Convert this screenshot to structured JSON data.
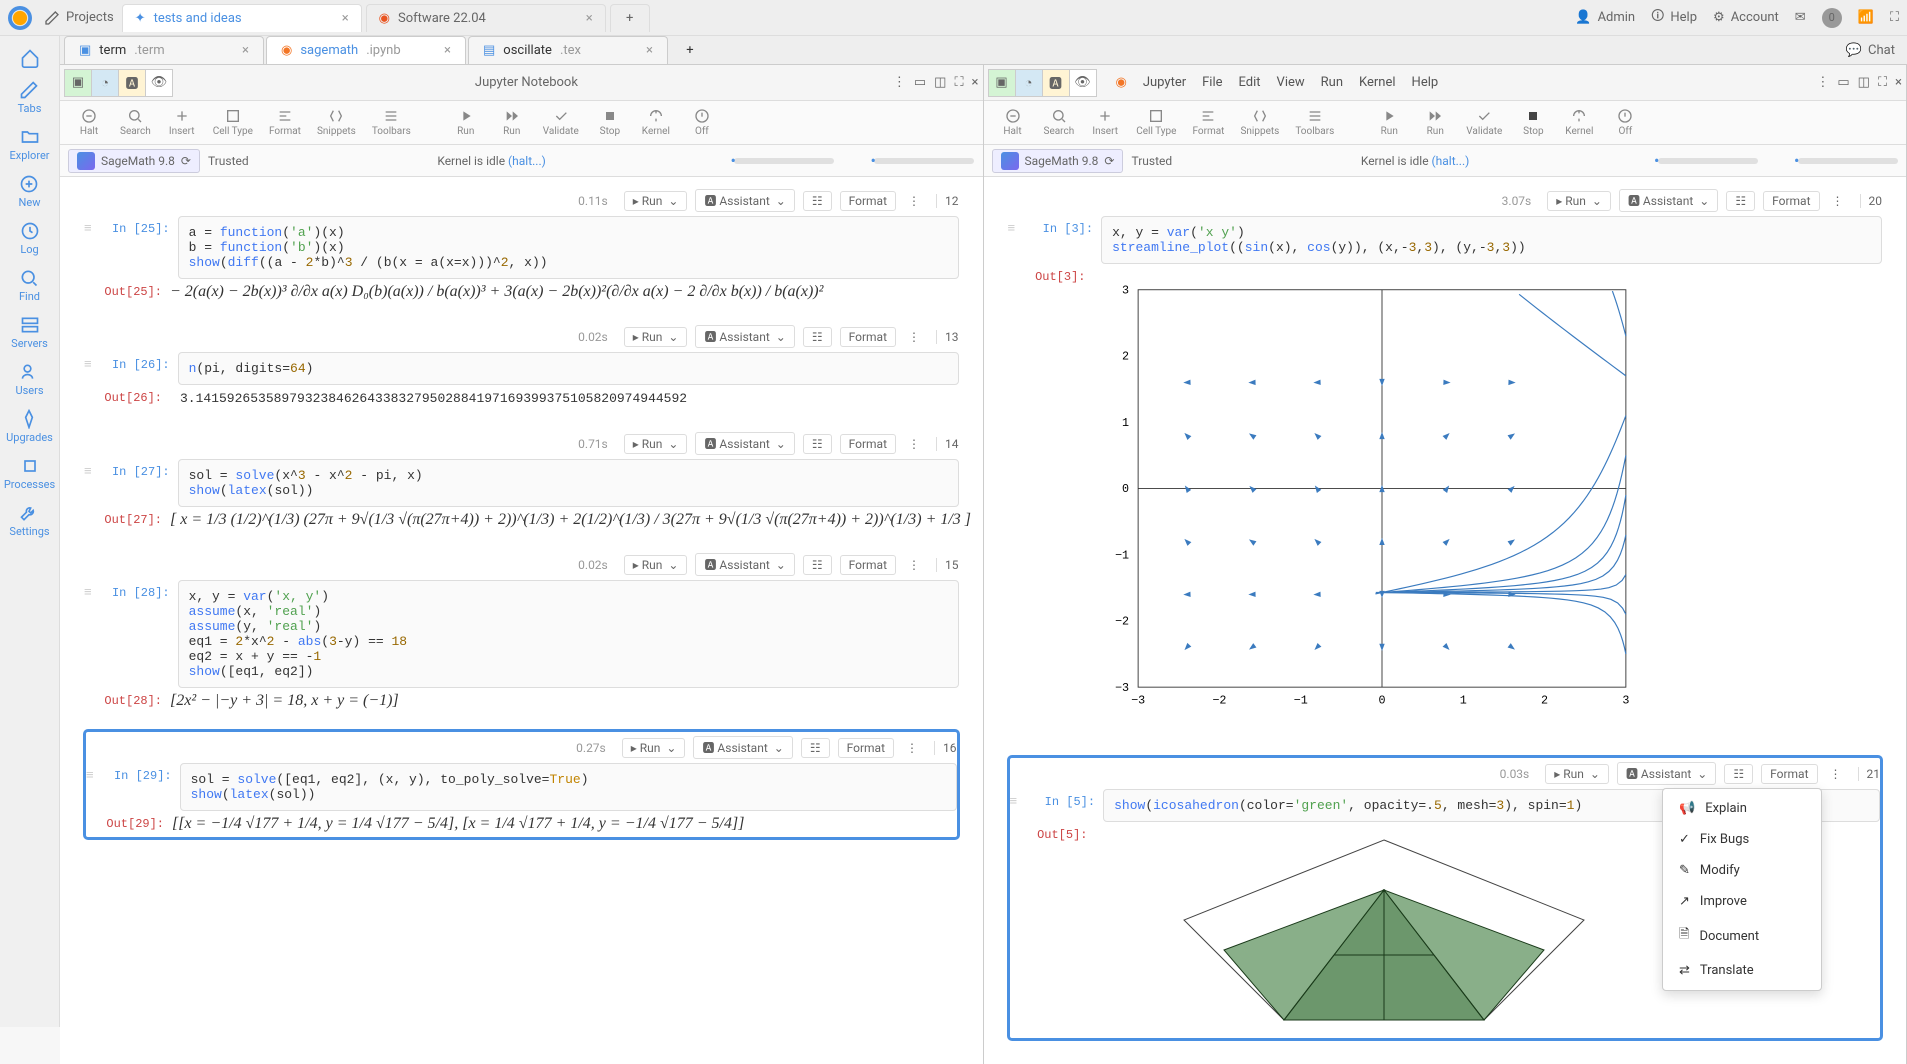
{
  "topbar": {
    "projects_label": "Projects",
    "tabs": [
      {
        "label": "tests and ideas",
        "active": true
      },
      {
        "label": "Software 22.04",
        "active": false
      }
    ],
    "admin": "Admin",
    "help": "Help",
    "account": "Account",
    "notif_count": "0"
  },
  "rail": {
    "tabs": "Tabs",
    "explorer": "Explorer",
    "new": "New",
    "log": "Log",
    "find": "Find",
    "servers": "Servers",
    "users": "Users",
    "upgrades": "Upgrades",
    "processes": "Processes",
    "settings": "Settings"
  },
  "file_tabs": [
    {
      "name": "term",
      "ext": ".term",
      "active": false
    },
    {
      "name": "sagemath",
      "ext": ".ipynb",
      "active": true
    },
    {
      "name": "oscillate",
      "ext": ".tex",
      "active": false
    }
  ],
  "chat_label": "Chat",
  "left_pane": {
    "header_title": "Jupyter Notebook",
    "kernel_name": "SageMath 9.8",
    "trusted": "Trusted",
    "kernel_status": "Kernel is idle",
    "halt": "(halt...)",
    "cells": [
      {
        "n": "12",
        "timing": "0.11s",
        "in_label": "In [25]:",
        "out_label": "Out[25]:",
        "code": "a = function('a')(x)\nb = function('b')(x)\nshow(diff((a - 2*b)^3 / (b(x = a(x=x)))^2, x))",
        "output_math": "− 2(a(x) − 2b(x))³ ∂/∂x a(x) D₀(b)(a(x)) / b(a(x))³  +  3(a(x) − 2b(x))²(∂/∂x a(x) − 2 ∂/∂x b(x)) / b(a(x))²"
      },
      {
        "n": "13",
        "timing": "0.02s",
        "in_label": "In [26]:",
        "out_label": "Out[26]:",
        "code": "n(pi, digits=64)",
        "output_text": "3.141592653589793238462643383279502884197169399375105820974944592"
      },
      {
        "n": "14",
        "timing": "0.71s",
        "in_label": "In [27]:",
        "out_label": "Out[27]:",
        "code": "sol = solve(x^3 - x^2 - pi, x)\nshow(latex(sol))",
        "output_math": "[ x = 1/3 (1/2)^(1/3) (27π + 9√(1/3 √(π(27π+4)) + 2))^(1/3)  +  2(1/2)^(1/3) / 3(27π + 9√(1/3 √(π(27π+4)) + 2))^(1/3)  +  1/3 ]"
      },
      {
        "n": "15",
        "timing": "0.02s",
        "in_label": "In [28]:",
        "out_label": "Out[28]:",
        "code": "x, y = var('x, y')\nassume(x, 'real')\nassume(y, 'real')\neq1 = 2*x^2 - abs(3-y) == 18\neq2 = x + y == -1\nshow([eq1, eq2])",
        "output_math": "[2x² − |−y + 3| = 18, x + y = (−1)]"
      },
      {
        "n": "16",
        "timing": "0.27s",
        "in_label": "In [29]:",
        "out_label": "Out[29]:",
        "selected": true,
        "code": "sol = solve([eq1, eq2], (x, y), to_poly_solve=True)\nshow(latex(sol))",
        "output_math": "[[x = −1/4 √177 + 1/4, y = 1/4 √177 − 5/4], [x = 1/4 √177 + 1/4, y = −1/4 √177 − 5/4]]"
      }
    ],
    "cell_buttons": {
      "run": "Run",
      "assistant": "Assistant",
      "format": "Format"
    }
  },
  "right_pane": {
    "menu": [
      "Jupyter",
      "File",
      "Edit",
      "View",
      "Run",
      "Kernel",
      "Help"
    ],
    "kernel_name": "SageMath 9.8",
    "trusted": "Trusted",
    "kernel_status": "Kernel is idle",
    "halt": "(halt...)",
    "cells": [
      {
        "n": "20",
        "timing": "3.07s",
        "in_label": "In [3]:",
        "out_label": "Out[3]:",
        "code": "x, y = var('x y')\nstreamline_plot((sin(x), cos(y)), (x,-3,3), (y,-3,3))",
        "plot": true
      },
      {
        "n": "21",
        "timing": "0.03s",
        "in_label": "In [5]:",
        "out_label": "Out[5]:",
        "selected": true,
        "code": "show(icosahedron(color='green', opacity=.5, mesh=3), spin=1)",
        "plot3d": true
      }
    ],
    "cell_buttons": {
      "run": "Run",
      "assistant": "Assistant",
      "format": "Format"
    }
  },
  "toolbar": {
    "halt": "Halt",
    "search": "Search",
    "insert": "Insert",
    "celltype": "Cell Type",
    "format": "Format",
    "snippets": "Snippets",
    "toolbars": "Toolbars",
    "run": "Run",
    "runall": "Run",
    "validate": "Validate",
    "stop": "Stop",
    "kernel": "Kernel",
    "off": "Off"
  },
  "assistant_menu": {
    "explain": "Explain",
    "fixbugs": "Fix Bugs",
    "modify": "Modify",
    "improve": "Improve",
    "document": "Document",
    "translate": "Translate"
  },
  "chart_data": {
    "type": "streamline",
    "title": "",
    "xlim": [
      -3,
      3
    ],
    "ylim": [
      -3,
      3
    ],
    "xticks": [
      -3,
      -2,
      -1,
      0,
      1,
      2,
      3
    ],
    "yticks": [
      -3,
      -2,
      -1,
      0,
      1,
      2,
      3
    ],
    "vector_field": "(sin(x), cos(y))",
    "series": [
      {
        "name": "streamlines",
        "color": "#3b7bbf"
      }
    ]
  }
}
